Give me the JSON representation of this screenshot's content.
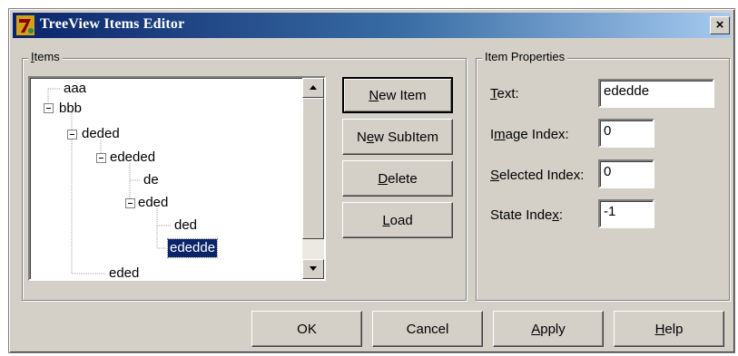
{
  "window": {
    "title": "TreeView Items Editor",
    "close_label": "×"
  },
  "items_group": {
    "label_accel": "I",
    "label_rest": "tems"
  },
  "tree": {
    "nodes": [
      {
        "label": "aaa",
        "level": 0,
        "expanded": null,
        "selected": false
      },
      {
        "label": "bbb",
        "level": 0,
        "expanded": true,
        "selected": false
      },
      {
        "label": "deded",
        "level": 1,
        "expanded": true,
        "selected": false
      },
      {
        "label": "ededed",
        "level": 2,
        "expanded": true,
        "selected": false
      },
      {
        "label": "de",
        "level": 3,
        "expanded": null,
        "selected": false
      },
      {
        "label": "eded",
        "level": 3,
        "expanded": true,
        "selected": false
      },
      {
        "label": "ded",
        "level": 4,
        "expanded": null,
        "selected": false
      },
      {
        "label": "ededde",
        "level": 4,
        "expanded": null,
        "selected": true
      },
      {
        "label": "eded",
        "level": 2,
        "expanded": null,
        "selected": false
      }
    ]
  },
  "item_buttons": {
    "new_item": {
      "accel": "N",
      "rest": "ew Item"
    },
    "new_subitem": {
      "pre": "N",
      "accel": "e",
      "rest": "w SubItem"
    },
    "delete": {
      "accel": "D",
      "rest": "elete"
    },
    "load": {
      "accel": "L",
      "rest": "oad"
    }
  },
  "properties": {
    "group_label": "Item Properties",
    "text": {
      "accel": "T",
      "rest": "ext:",
      "value": "ededde"
    },
    "image_index": {
      "pre": "I",
      "accel": "m",
      "rest": "age Index:",
      "value": "0"
    },
    "selected_index": {
      "accel": "S",
      "rest": "elected Index:",
      "value": "0"
    },
    "state_index": {
      "pre": "State Inde",
      "accel": "x",
      "rest": ":",
      "value": "-1"
    }
  },
  "footer_buttons": {
    "ok": "OK",
    "cancel": "Cancel",
    "apply": {
      "accel": "A",
      "rest": "pply"
    },
    "help": {
      "accel": "H",
      "rest": "elp"
    }
  },
  "colors": {
    "face": "#d4d0c8",
    "title_start": "#0a246a",
    "title_end": "#a6caf0",
    "selection": "#0a246a"
  }
}
